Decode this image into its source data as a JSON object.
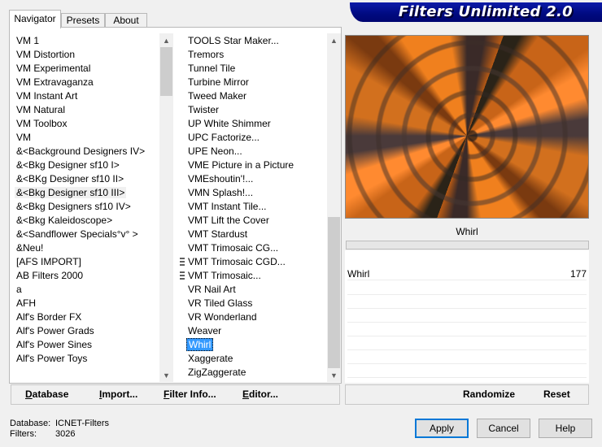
{
  "tabs": [
    {
      "label": "Navigator",
      "active": true
    },
    {
      "label": "Presets",
      "active": false
    },
    {
      "label": "About",
      "active": false
    }
  ],
  "app_title": "Filters Unlimited 2.0",
  "categories": [
    "VM 1",
    "VM Distortion",
    "VM Experimental",
    "VM Extravaganza",
    "VM Instant Art",
    "VM Natural",
    "VM Toolbox",
    "VM",
    "&<Background Designers IV>",
    "&<Bkg Designer sf10 I>",
    "&<BKg Designer sf10 II>",
    "&<Bkg Designer sf10 III>",
    "&<Bkg Designers sf10 IV>",
    "&<Bkg Kaleidoscope>",
    "&<Sandflower Specials°v° >",
    "&Neu!",
    "[AFS IMPORT]",
    "AB Filters 2000",
    "a",
    "AFH",
    "Alf's Border FX",
    "Alf's Power Grads",
    "Alf's Power Sines",
    "Alf's Power Toys"
  ],
  "selected_category": "&<Bkg Designer sf10 III>",
  "filters": [
    "TOOLS Star Maker...",
    "Tremors",
    "Tunnel Tile",
    "Turbine Mirror",
    "Tweed Maker",
    "Twister",
    "UP White Shimmer",
    "UPC Factorize...",
    "UPE Neon...",
    "VME Picture in a Picture",
    "VMEshoutin'!...",
    "VMN Splash!...",
    "VMT Instant Tile...",
    "VMT Lift the Cover",
    "VMT Stardust",
    "VMT Trimosaic CG...",
    "VMT Trimosaic CGD...",
    "VMT Trimosaic...",
    "VR Nail Art",
    "VR Tiled Glass",
    "VR Wonderland",
    "Weaver",
    "Whirl",
    "Xaggerate",
    "ZigZaggerate"
  ],
  "selected_filter": "Whirl",
  "grip_rows": [
    16,
    17
  ],
  "left_buttons": [
    {
      "key": "D",
      "rest": "atabase"
    },
    {
      "key": "I",
      "rest": "mport..."
    },
    {
      "key": "F",
      "rest": "ilter Info..."
    },
    {
      "key": "E",
      "rest": "ditor..."
    }
  ],
  "preview_filter_name": "Whirl",
  "parameters": [
    {
      "label": "Whirl",
      "value": "177",
      "fraction": 0.694
    }
  ],
  "right_buttons": {
    "randomize": "Randomize",
    "reset": "Reset"
  },
  "database_label": "Database:",
  "database_value": "ICNET-Filters",
  "filters_label": "Filters:",
  "filters_count": "3026",
  "dialog_buttons": {
    "apply": "Apply",
    "cancel": "Cancel",
    "help": "Help"
  },
  "icons": {
    "scroll_up": "scroll-up-arrow-icon",
    "scroll_down": "scroll-down-arrow-icon",
    "grip": "drag-grip-icon"
  }
}
